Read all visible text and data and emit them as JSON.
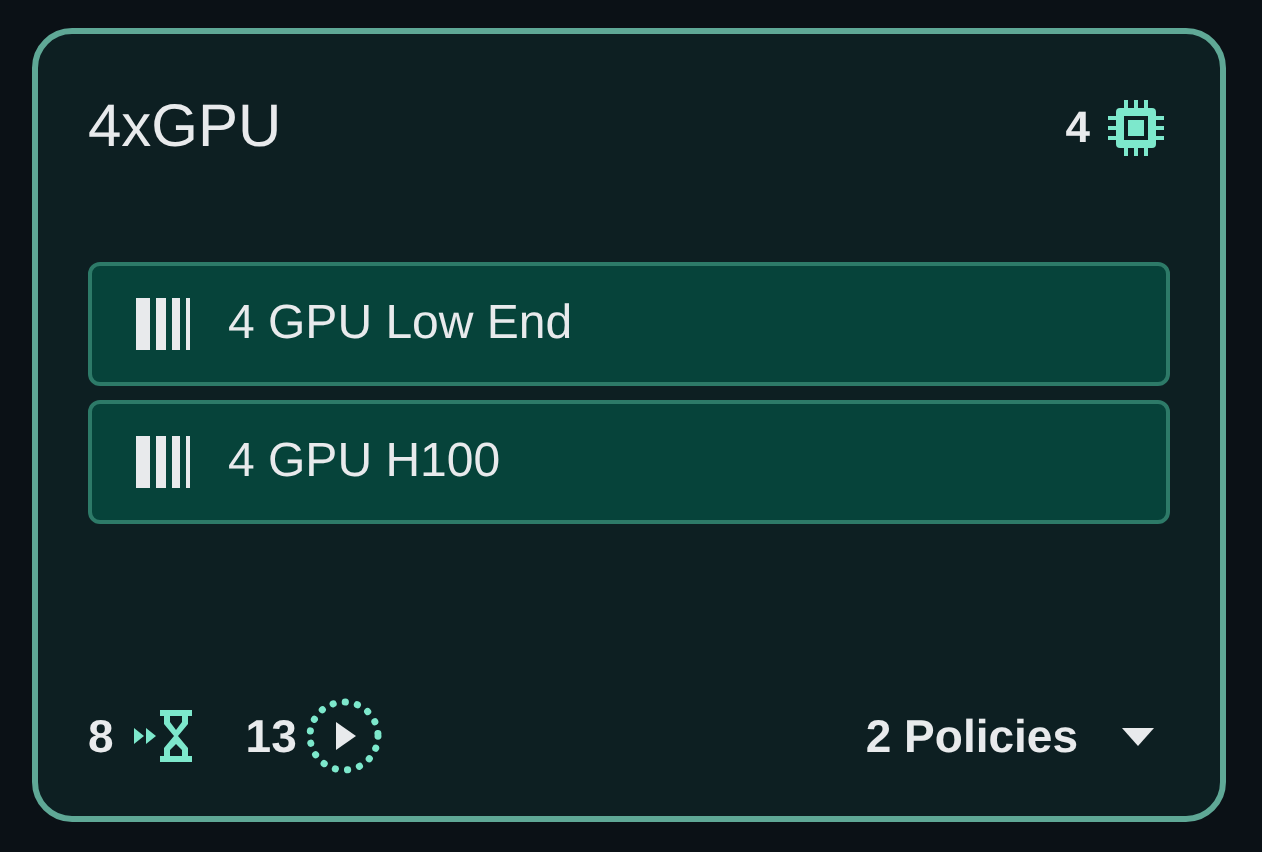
{
  "card": {
    "title": "4xGPU",
    "gpu_count": "4",
    "items": [
      {
        "label": "4 GPU Low End"
      },
      {
        "label": "4 GPU H100"
      }
    ],
    "footer": {
      "queued": "8",
      "running": "13",
      "policies": "2 Policies"
    }
  }
}
